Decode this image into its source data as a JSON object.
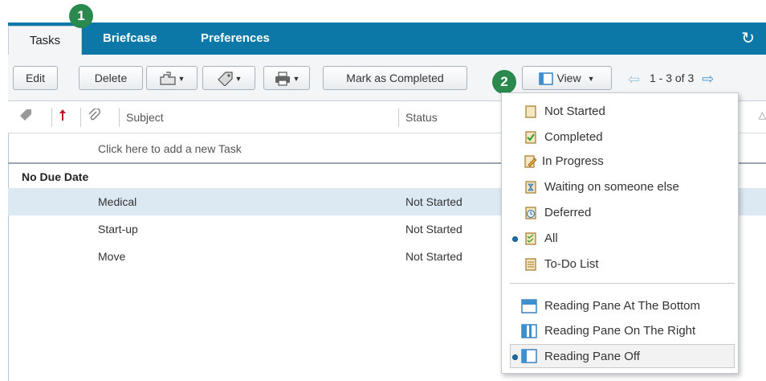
{
  "callouts": [
    "1",
    "2"
  ],
  "tabs": {
    "tasks": "Tasks",
    "briefcase": "Briefcase",
    "preferences": "Preferences"
  },
  "toolbar": {
    "edit": "Edit",
    "delete": "Delete",
    "mark_completed": "Mark as Completed",
    "view": "View",
    "pager": "1 - 3 of 3"
  },
  "columns": {
    "subject": "Subject",
    "status": "Status"
  },
  "add_task_hint": "Click here to add a new Task",
  "group_label": "No Due Date",
  "tasks": [
    {
      "subject": "Medical",
      "status": "Not Started"
    },
    {
      "subject": "Start-up",
      "status": "Not Started"
    },
    {
      "subject": "Move",
      "status": "Not Started"
    }
  ],
  "view_menu": {
    "filters": [
      {
        "label": "Not Started",
        "icon": "not-started-icon"
      },
      {
        "label": "Completed",
        "icon": "completed-icon"
      },
      {
        "label": "In Progress",
        "icon": "in-progress-icon"
      },
      {
        "label": "Waiting on someone else",
        "icon": "waiting-icon"
      },
      {
        "label": "Deferred",
        "icon": "deferred-icon"
      },
      {
        "label": "All",
        "icon": "all-icon",
        "selected": true
      },
      {
        "label": "To-Do List",
        "icon": "todo-list-icon"
      }
    ],
    "panes": [
      {
        "label": "Reading Pane At The Bottom",
        "icon": "reading-pane-bottom-icon"
      },
      {
        "label": "Reading Pane On The Right",
        "icon": "reading-pane-right-icon"
      },
      {
        "label": "Reading Pane Off",
        "icon": "reading-pane-off-icon",
        "selected": true
      }
    ]
  },
  "colors": {
    "tab_bar": "#0c78a8",
    "callout": "#2a8a4e",
    "selected_row": "#dce8f2"
  }
}
